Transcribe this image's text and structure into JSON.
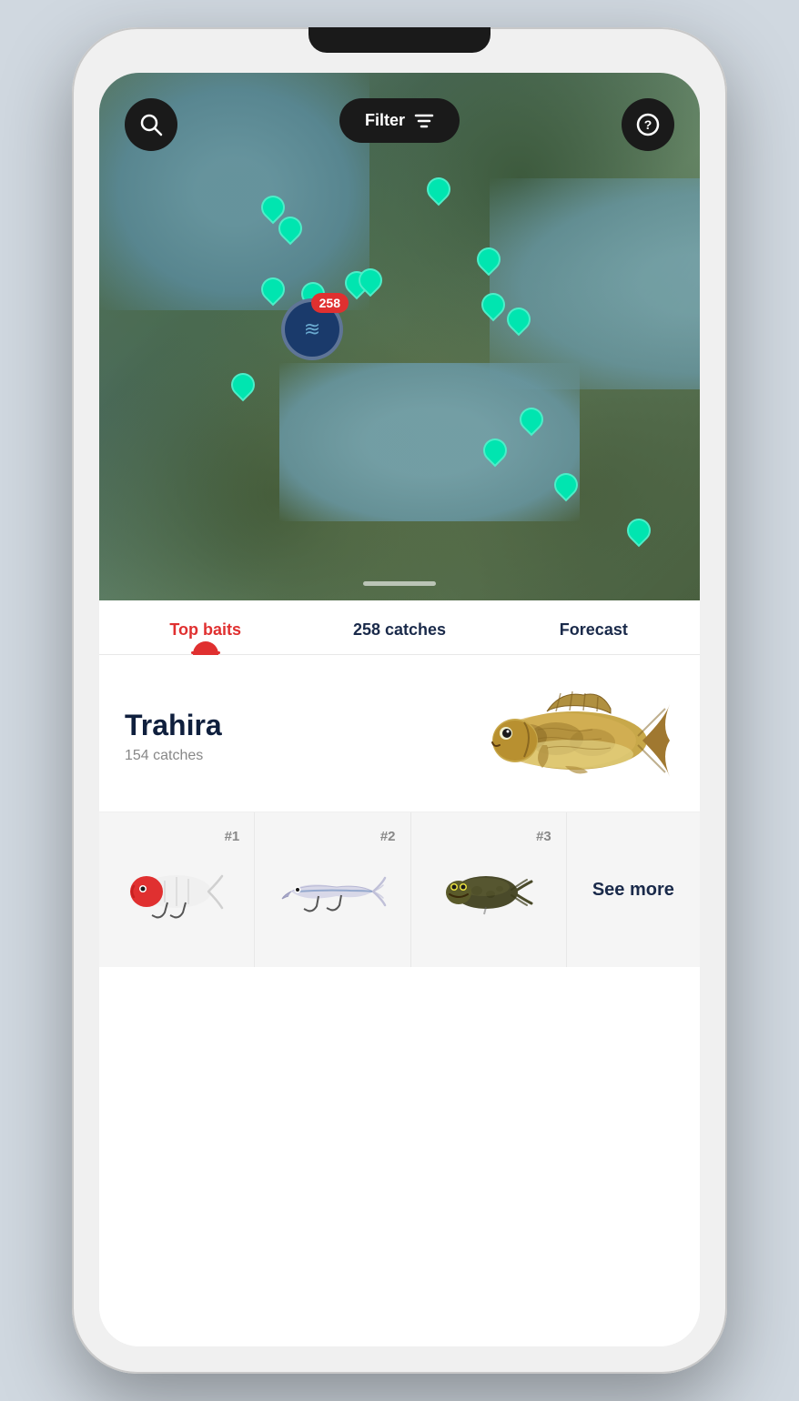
{
  "phone": {
    "map": {
      "filter_label": "Filter",
      "search_icon": "search",
      "help_icon": "?",
      "cluster_count": "258",
      "scroll_indicator": true
    },
    "tabs": [
      {
        "id": "top-baits",
        "label": "Top baits",
        "active": true
      },
      {
        "id": "catches",
        "label": "258 catches",
        "active": false
      },
      {
        "id": "forecast",
        "label": "Forecast",
        "active": false
      }
    ],
    "fish": {
      "name": "Trahira",
      "catches": "154 catches"
    },
    "baits": [
      {
        "rank": "#1",
        "type": "popper-red-white"
      },
      {
        "rank": "#2",
        "type": "jerkbait-silver"
      },
      {
        "rank": "#3",
        "type": "frog-lure"
      }
    ],
    "see_more": {
      "label": "See more"
    }
  }
}
